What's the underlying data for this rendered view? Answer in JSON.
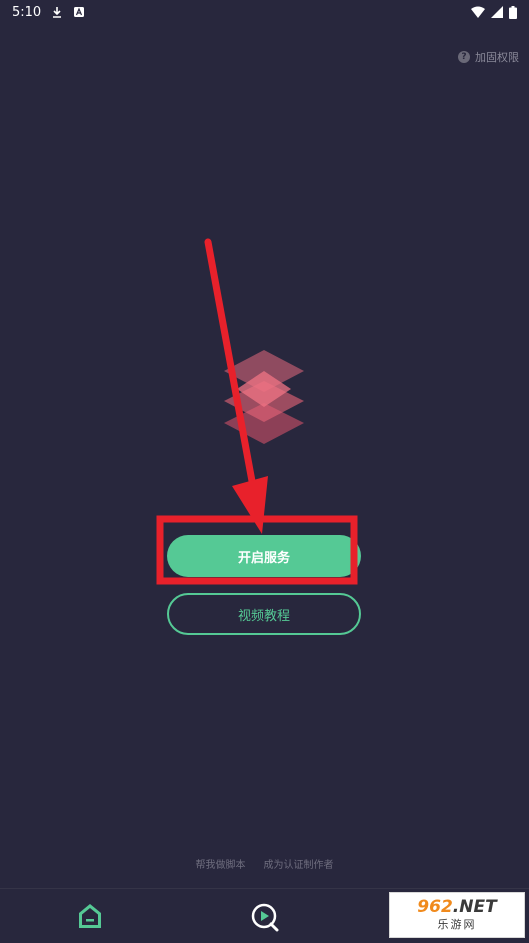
{
  "status_bar": {
    "time": "5:10"
  },
  "header": {
    "help_label": "加固权限"
  },
  "main": {
    "start_button_label": "开启服务",
    "video_button_label": "视频教程"
  },
  "footer": {
    "links": [
      "帮我做脚本",
      "成为认证制作者"
    ]
  },
  "nav": {
    "items": [
      "home-icon",
      "play-icon"
    ]
  },
  "watermark": {
    "brand_number": "962",
    "brand_suffix": ".NET",
    "site_name": "乐游网"
  },
  "colors": {
    "background": "#28273d",
    "accent": "#55c995",
    "annotation_red": "#e8212b"
  }
}
